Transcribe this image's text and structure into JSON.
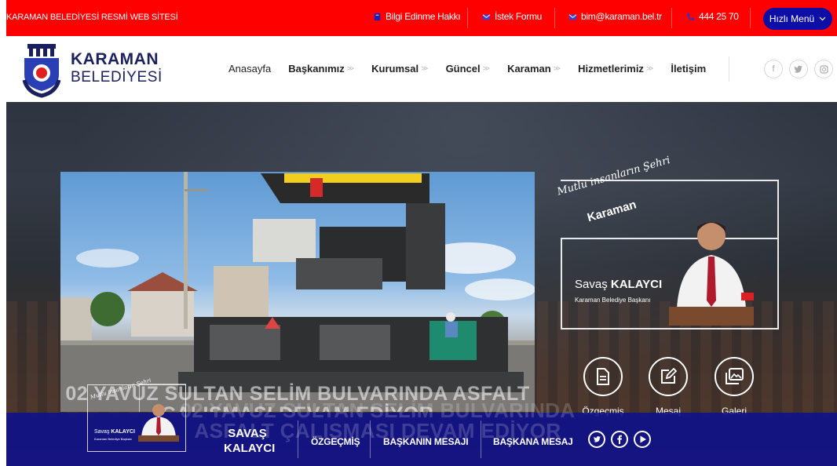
{
  "topbar": {
    "site_title": "KARAMAN BELEDİYESİ RESMİ WEB SİTESİ",
    "links": [
      {
        "label": "Bilgi Edinme Hakkı",
        "icon": "book-icon"
      },
      {
        "label": "İstek Formu",
        "icon": "envelope-icon"
      },
      {
        "label": "bim@karaman.bel.tr",
        "icon": "envelope-icon"
      },
      {
        "label": "444 25 70",
        "icon": "phone-icon"
      }
    ],
    "quick_menu": "Hızlı Menü"
  },
  "logo": {
    "line1": "KARAMAN",
    "line2": "BELEDİYESİ",
    "emblem_text": "KARAMAN BELEDİYESİ"
  },
  "nav": {
    "items": [
      {
        "label": "Anasayfa",
        "has_dropdown": false
      },
      {
        "label": "Başkanımız",
        "has_dropdown": true
      },
      {
        "label": "Kurumsal",
        "has_dropdown": true
      },
      {
        "label": "Güncel",
        "has_dropdown": true
      },
      {
        "label": "Karaman",
        "has_dropdown": true
      },
      {
        "label": "Hizmetlerimiz",
        "has_dropdown": true
      },
      {
        "label": "İletişim",
        "has_dropdown": false
      }
    ],
    "chevron": "≫"
  },
  "social": [
    "facebook-icon",
    "twitter-icon",
    "instagram-icon"
  ],
  "hero": {
    "slide_caption": "02 YAVUZ SULTAN SELİM BULVARINDA ASFALT ÇALIŞMASI DEVAM EDİYOR",
    "slogan": "Mutlu insanların Şehri",
    "slogan_city": "Karaman",
    "mayor_first": "Savaş",
    "mayor_last": "KALAYCI",
    "mayor_role": "Karaman Belediye Başkanı",
    "actions": [
      {
        "label": "Özgeçmiş",
        "icon": "document-icon"
      },
      {
        "label": "Mesaj",
        "icon": "edit-icon"
      },
      {
        "label": "Galeri",
        "icon": "gallery-icon"
      }
    ]
  },
  "bottombar": {
    "mayor_line1": "SAVAŞ",
    "mayor_line2": "KALAYCI",
    "links": [
      "ÖZGEÇMİŞ",
      "BAŞKANIN MESAJI",
      "BAŞKANA MESAJ"
    ],
    "icons": [
      "twitter-icon",
      "facebook-icon",
      "play-icon"
    ]
  },
  "colors": {
    "topbar": "#ff0000",
    "accent_blue": "#0d0ea6",
    "logo_text": "#1a1f5e"
  }
}
